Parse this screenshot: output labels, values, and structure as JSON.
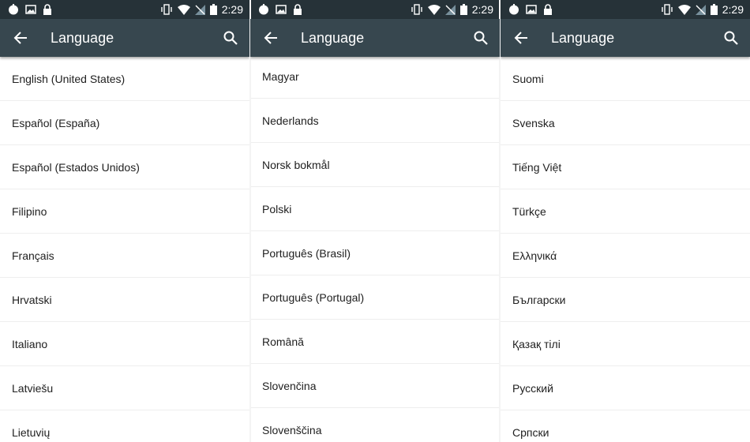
{
  "status_bar": {
    "time": "2:29",
    "left_icons": [
      "notification-blob-icon",
      "image-icon",
      "lock-icon"
    ],
    "right_icons": [
      "vibrate-icon",
      "wifi-icon",
      "no-sim-icon",
      "battery-icon"
    ]
  },
  "panels": [
    {
      "toolbar": {
        "title": "Language"
      },
      "items": [
        "English (United States)",
        "Español (España)",
        "Español (Estados Unidos)",
        "Filipino",
        "Français",
        "Hrvatski",
        "Italiano",
        "Latviešu",
        "Lietuvių"
      ]
    },
    {
      "toolbar": {
        "title": "Language"
      },
      "items": [
        "Magyar",
        "Nederlands",
        "Norsk bokmål",
        "Polski",
        "Português (Brasil)",
        "Português (Portugal)",
        "Română",
        "Slovenčina",
        "Slovenščina"
      ]
    },
    {
      "toolbar": {
        "title": "Language"
      },
      "items": [
        "Suomi",
        "Svenska",
        "Tiếng Việt",
        "Türkçe",
        "Ελληνικά",
        "Български",
        "Қазақ тілі",
        "Русский",
        "Српски"
      ]
    }
  ],
  "colors": {
    "status_bar": "#263238",
    "toolbar": "#37474f",
    "text": "#212121"
  }
}
